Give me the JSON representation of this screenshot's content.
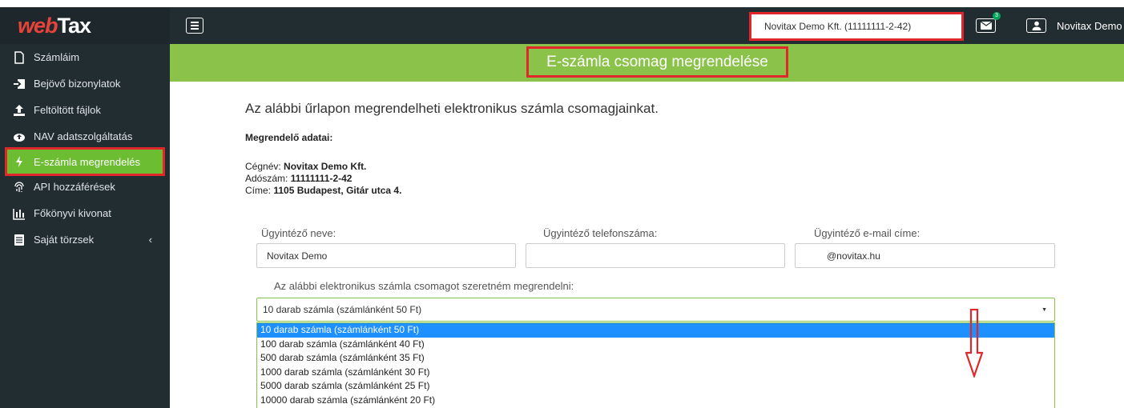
{
  "logo": {
    "part1": "web",
    "part2": "Tax"
  },
  "sidebar": {
    "items": [
      {
        "label": "Számláim",
        "icon": "file-icon"
      },
      {
        "label": "Bejövő bizonylatok",
        "icon": "sign-in-icon"
      },
      {
        "label": "Feltöltött fájlok",
        "icon": "upload-icon"
      },
      {
        "label": "NAV adatszolgáltatás",
        "icon": "cloud-upload-icon"
      },
      {
        "label": "E-számla megrendelés",
        "icon": "bolt-icon",
        "active": true
      },
      {
        "label": "API hozzáférések",
        "icon": "fingerprint-icon"
      },
      {
        "label": "Főkönyvi kivonat",
        "icon": "bar-chart-icon"
      },
      {
        "label": "Saját törzsek",
        "icon": "book-icon"
      }
    ]
  },
  "header": {
    "company": "Novitax Demo Kft. (11111111-2-42)",
    "mail_badge": "3",
    "user_name": "Novitax Demo"
  },
  "page": {
    "title": "E-számla csomag megrendelése",
    "intro": "Az alábbi űrlapon megrendelheti elektronikus számla csomagjainkat.",
    "section_title": "Megrendelő adatai:",
    "company_label": "Cégnév:",
    "company_value": "Novitax Demo Kft.",
    "tax_label": "Adószám:",
    "tax_value": "11111111-2-42",
    "address_label": "Címe:",
    "address_value": "1105 Budapest, Gitár utca 4."
  },
  "form": {
    "name_label": "Ügyintéző neve:",
    "name_value": "Novitax Demo",
    "phone_label": "Ügyintéző telefonszáma:",
    "phone_value": "",
    "email_label": "Ügyintéző e-mail címe:",
    "email_value": "@novitax.hu",
    "package_label": "Az alábbi elektronikus számla csomagot szeretném megrendelni:",
    "package_selected": "10 darab számla (számlánként 50 Ft)",
    "package_options": [
      "10 darab számla (számlánként 50 Ft)",
      "100 darab számla (számlánként 40 Ft)",
      "500 darab számla (számlánként 35 Ft)",
      "1000 darab számla (számlánként 30 Ft)",
      "5000 darab számla (számlánként 25 Ft)",
      "10000 darab számla (számlánként 20 Ft)"
    ]
  },
  "colors": {
    "sidebar": "#222d32",
    "accent_green": "#8bc34a",
    "highlight_red": "#e0272b",
    "selected_option": "#1e90ff"
  }
}
